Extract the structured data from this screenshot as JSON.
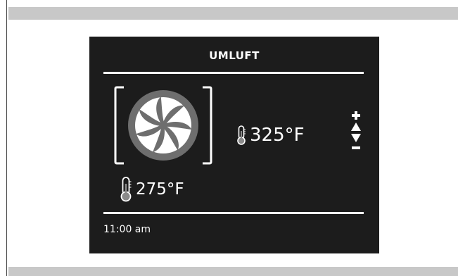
{
  "program": {
    "title": "UMLUFT"
  },
  "temperatures": {
    "current": "275°F",
    "setpoint": "325°F"
  },
  "status": {
    "time": "11:00 am"
  },
  "icons": {
    "fan": "convection-fan-icon",
    "thermometer_current": "thermometer-icon",
    "thermometer_setpoint": "thermometer-icon",
    "increase": "plus-arrow-up-icon",
    "decrease": "minus-arrow-down-icon"
  },
  "colors": {
    "screen_background": "#1c1c1c",
    "foreground": "#ffffff",
    "fan_ring": "#6e6e6e",
    "thermometer_bulb": "#8a8a8a"
  }
}
